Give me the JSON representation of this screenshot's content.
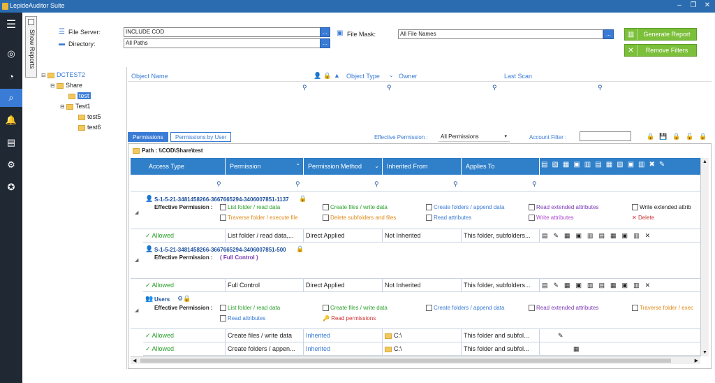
{
  "app": {
    "title": "LepideAuditor Suite"
  },
  "sidebar": {
    "show_reports": "Show Reports"
  },
  "filters": {
    "file_server_label": "File Server:",
    "file_server_value": "INCLUDE COD",
    "directory_label": "Directory:",
    "directory_value": "All Paths",
    "file_mask_label": "File Mask:",
    "file_mask_value": "All File Names",
    "dots": "..."
  },
  "buttons": {
    "generate": "Generate Report",
    "remove": "Remove Filters"
  },
  "tree": {
    "root": "DCTEST2",
    "share": "Share",
    "test": "test",
    "test1": "Test1",
    "test5": "test5",
    "test6": "test6"
  },
  "objects": {
    "headers": [
      "Object Name",
      "Object Type",
      "Owner",
      "Last Scan"
    ]
  },
  "tabs": {
    "permissions": "Permissions",
    "by_user": "Permissions by User"
  },
  "effective": {
    "label": "Effective Permission :",
    "value": "All Permissions",
    "account_label": "Account Filter :"
  },
  "path": "Path : \\\\COD\\Share\\test",
  "grid": {
    "headers": [
      "Access Type",
      "Permission",
      "Permission Method",
      "Inherited From",
      "Applies To"
    ],
    "group1": {
      "sid": "S-1-5-21-3481458266-3667665294-3406007851-1137",
      "eff_label": "Effective Permission :",
      "perms": [
        "List folder / read data",
        "Create files / write data",
        "Create folders / append data",
        "Read extended attributes",
        "Write extended attrib",
        "Traverse folder / execute file",
        "Delete subfolders and files",
        "Read attributes",
        "Write attributes",
        "Delete"
      ],
      "row": {
        "access": "Allowed",
        "permission": "List folder / read data,...",
        "method": "Direct Applied",
        "inherited": "Not Inherited",
        "applies": "This folder, subfolders..."
      }
    },
    "group2": {
      "sid": "S-1-5-21-3481458266-3667665294-3406007851-500",
      "eff_label": "Effective Permission :",
      "eff_value": "( Full Control )",
      "row": {
        "access": "Allowed",
        "permission": "Full Control",
        "method": "Direct Applied",
        "inherited": "Not Inherited",
        "applies": "This folder, subfolders..."
      }
    },
    "group3": {
      "name": "Users",
      "eff_label": "Effective Permission :",
      "perms": [
        "List folder / read data",
        "Create files / write data",
        "Create folders / append data",
        "Read extended attributes",
        "Traverse folder / exec",
        "Read attributes",
        "Read permissions"
      ],
      "rows": [
        {
          "access": "Allowed",
          "permission": "Create files / write data",
          "method": "Inherited",
          "inherited": "C:\\",
          "applies": "This folder and subfol..."
        },
        {
          "access": "Allowed",
          "permission": "Create folders / appen...",
          "method": "Inherited",
          "inherited": "C:\\",
          "applies": "This folder and subfol..."
        }
      ]
    }
  },
  "colors": {
    "accent": "#3a7bd5",
    "sidebar": "#1f2833",
    "green": "#7cbf3a"
  }
}
